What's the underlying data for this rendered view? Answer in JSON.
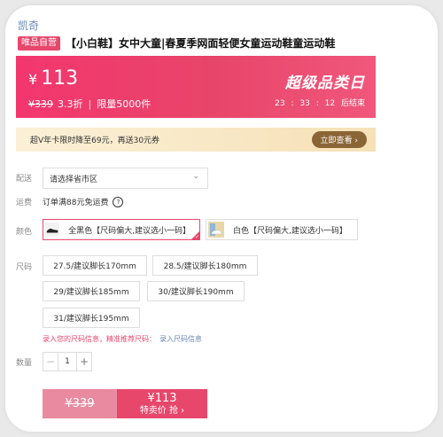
{
  "brand": "凯奇",
  "product": {
    "badge": "唯品自营",
    "title": "【小白鞋】女中大童|春夏季网面轻便女童运动鞋童运动鞋"
  },
  "price": {
    "currency": "¥",
    "current": "113",
    "original": "¥339",
    "discount": "3.3折",
    "separator": "|",
    "limit": "限量5000件",
    "promo_title": "超级品类日",
    "countdown": [
      "23",
      ":",
      "33",
      ":",
      "12",
      "后结束"
    ]
  },
  "coupon": {
    "text": "超V年卡限时降至69元，再送30元券",
    "button": "立即查看 ›"
  },
  "labels": {
    "ship": "配送",
    "freight": "运费",
    "color": "颜色",
    "size": "尺码",
    "qty": "数量"
  },
  "shipping": {
    "placeholder": "请选择省市区",
    "chevron": "⌄"
  },
  "freight": {
    "text": "订单满88元免运费",
    "help_icon": "?"
  },
  "colors": [
    {
      "label": "全黑色【尺码偏大,建议选小一码】",
      "selected": true
    },
    {
      "label": "白色【尺码偏大,建议选小一码】",
      "selected": false
    }
  ],
  "sizes": [
    "27.5/建议脚长170mm",
    "28.5/建议脚长180mm",
    "29/建议脚长185mm",
    "30/建议脚长190mm",
    "31/建议脚长195mm"
  ],
  "size_hint": {
    "text": "录入您的尺码信息，精准推荐尺码：",
    "link": "录入尺码信息"
  },
  "quantity": {
    "minus": "−",
    "value": "1",
    "plus": "+"
  },
  "buy": {
    "original": "¥339",
    "price": "¥113",
    "label": "特卖价 抢 ›"
  },
  "colors_theme": {
    "accent": "#e8476c",
    "gold_btn": "#8a6536"
  }
}
